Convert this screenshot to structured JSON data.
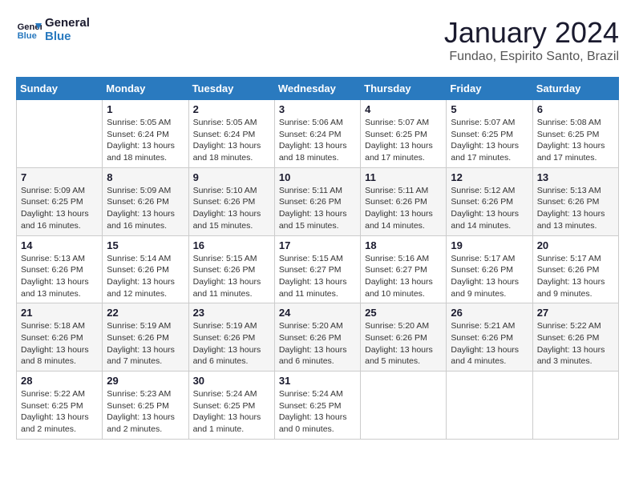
{
  "logo": {
    "line1": "General",
    "line2": "Blue"
  },
  "title": "January 2024",
  "subtitle": "Fundao, Espirito Santo, Brazil",
  "weekdays": [
    "Sunday",
    "Monday",
    "Tuesday",
    "Wednesday",
    "Thursday",
    "Friday",
    "Saturday"
  ],
  "weeks": [
    [
      {
        "day": "",
        "info": ""
      },
      {
        "day": "1",
        "info": "Sunrise: 5:05 AM\nSunset: 6:24 PM\nDaylight: 13 hours\nand 18 minutes."
      },
      {
        "day": "2",
        "info": "Sunrise: 5:05 AM\nSunset: 6:24 PM\nDaylight: 13 hours\nand 18 minutes."
      },
      {
        "day": "3",
        "info": "Sunrise: 5:06 AM\nSunset: 6:24 PM\nDaylight: 13 hours\nand 18 minutes."
      },
      {
        "day": "4",
        "info": "Sunrise: 5:07 AM\nSunset: 6:25 PM\nDaylight: 13 hours\nand 17 minutes."
      },
      {
        "day": "5",
        "info": "Sunrise: 5:07 AM\nSunset: 6:25 PM\nDaylight: 13 hours\nand 17 minutes."
      },
      {
        "day": "6",
        "info": "Sunrise: 5:08 AM\nSunset: 6:25 PM\nDaylight: 13 hours\nand 17 minutes."
      }
    ],
    [
      {
        "day": "7",
        "info": "Sunrise: 5:09 AM\nSunset: 6:25 PM\nDaylight: 13 hours\nand 16 minutes."
      },
      {
        "day": "8",
        "info": "Sunrise: 5:09 AM\nSunset: 6:26 PM\nDaylight: 13 hours\nand 16 minutes."
      },
      {
        "day": "9",
        "info": "Sunrise: 5:10 AM\nSunset: 6:26 PM\nDaylight: 13 hours\nand 15 minutes."
      },
      {
        "day": "10",
        "info": "Sunrise: 5:11 AM\nSunset: 6:26 PM\nDaylight: 13 hours\nand 15 minutes."
      },
      {
        "day": "11",
        "info": "Sunrise: 5:11 AM\nSunset: 6:26 PM\nDaylight: 13 hours\nand 14 minutes."
      },
      {
        "day": "12",
        "info": "Sunrise: 5:12 AM\nSunset: 6:26 PM\nDaylight: 13 hours\nand 14 minutes."
      },
      {
        "day": "13",
        "info": "Sunrise: 5:13 AM\nSunset: 6:26 PM\nDaylight: 13 hours\nand 13 minutes."
      }
    ],
    [
      {
        "day": "14",
        "info": "Sunrise: 5:13 AM\nSunset: 6:26 PM\nDaylight: 13 hours\nand 13 minutes."
      },
      {
        "day": "15",
        "info": "Sunrise: 5:14 AM\nSunset: 6:26 PM\nDaylight: 13 hours\nand 12 minutes."
      },
      {
        "day": "16",
        "info": "Sunrise: 5:15 AM\nSunset: 6:26 PM\nDaylight: 13 hours\nand 11 minutes."
      },
      {
        "day": "17",
        "info": "Sunrise: 5:15 AM\nSunset: 6:27 PM\nDaylight: 13 hours\nand 11 minutes."
      },
      {
        "day": "18",
        "info": "Sunrise: 5:16 AM\nSunset: 6:27 PM\nDaylight: 13 hours\nand 10 minutes."
      },
      {
        "day": "19",
        "info": "Sunrise: 5:17 AM\nSunset: 6:26 PM\nDaylight: 13 hours\nand 9 minutes."
      },
      {
        "day": "20",
        "info": "Sunrise: 5:17 AM\nSunset: 6:26 PM\nDaylight: 13 hours\nand 9 minutes."
      }
    ],
    [
      {
        "day": "21",
        "info": "Sunrise: 5:18 AM\nSunset: 6:26 PM\nDaylight: 13 hours\nand 8 minutes."
      },
      {
        "day": "22",
        "info": "Sunrise: 5:19 AM\nSunset: 6:26 PM\nDaylight: 13 hours\nand 7 minutes."
      },
      {
        "day": "23",
        "info": "Sunrise: 5:19 AM\nSunset: 6:26 PM\nDaylight: 13 hours\nand 6 minutes."
      },
      {
        "day": "24",
        "info": "Sunrise: 5:20 AM\nSunset: 6:26 PM\nDaylight: 13 hours\nand 6 minutes."
      },
      {
        "day": "25",
        "info": "Sunrise: 5:20 AM\nSunset: 6:26 PM\nDaylight: 13 hours\nand 5 minutes."
      },
      {
        "day": "26",
        "info": "Sunrise: 5:21 AM\nSunset: 6:26 PM\nDaylight: 13 hours\nand 4 minutes."
      },
      {
        "day": "27",
        "info": "Sunrise: 5:22 AM\nSunset: 6:26 PM\nDaylight: 13 hours\nand 3 minutes."
      }
    ],
    [
      {
        "day": "28",
        "info": "Sunrise: 5:22 AM\nSunset: 6:25 PM\nDaylight: 13 hours\nand 2 minutes."
      },
      {
        "day": "29",
        "info": "Sunrise: 5:23 AM\nSunset: 6:25 PM\nDaylight: 13 hours\nand 2 minutes."
      },
      {
        "day": "30",
        "info": "Sunrise: 5:24 AM\nSunset: 6:25 PM\nDaylight: 13 hours\nand 1 minute."
      },
      {
        "day": "31",
        "info": "Sunrise: 5:24 AM\nSunset: 6:25 PM\nDaylight: 13 hours\nand 0 minutes."
      },
      {
        "day": "",
        "info": ""
      },
      {
        "day": "",
        "info": ""
      },
      {
        "day": "",
        "info": ""
      }
    ]
  ]
}
